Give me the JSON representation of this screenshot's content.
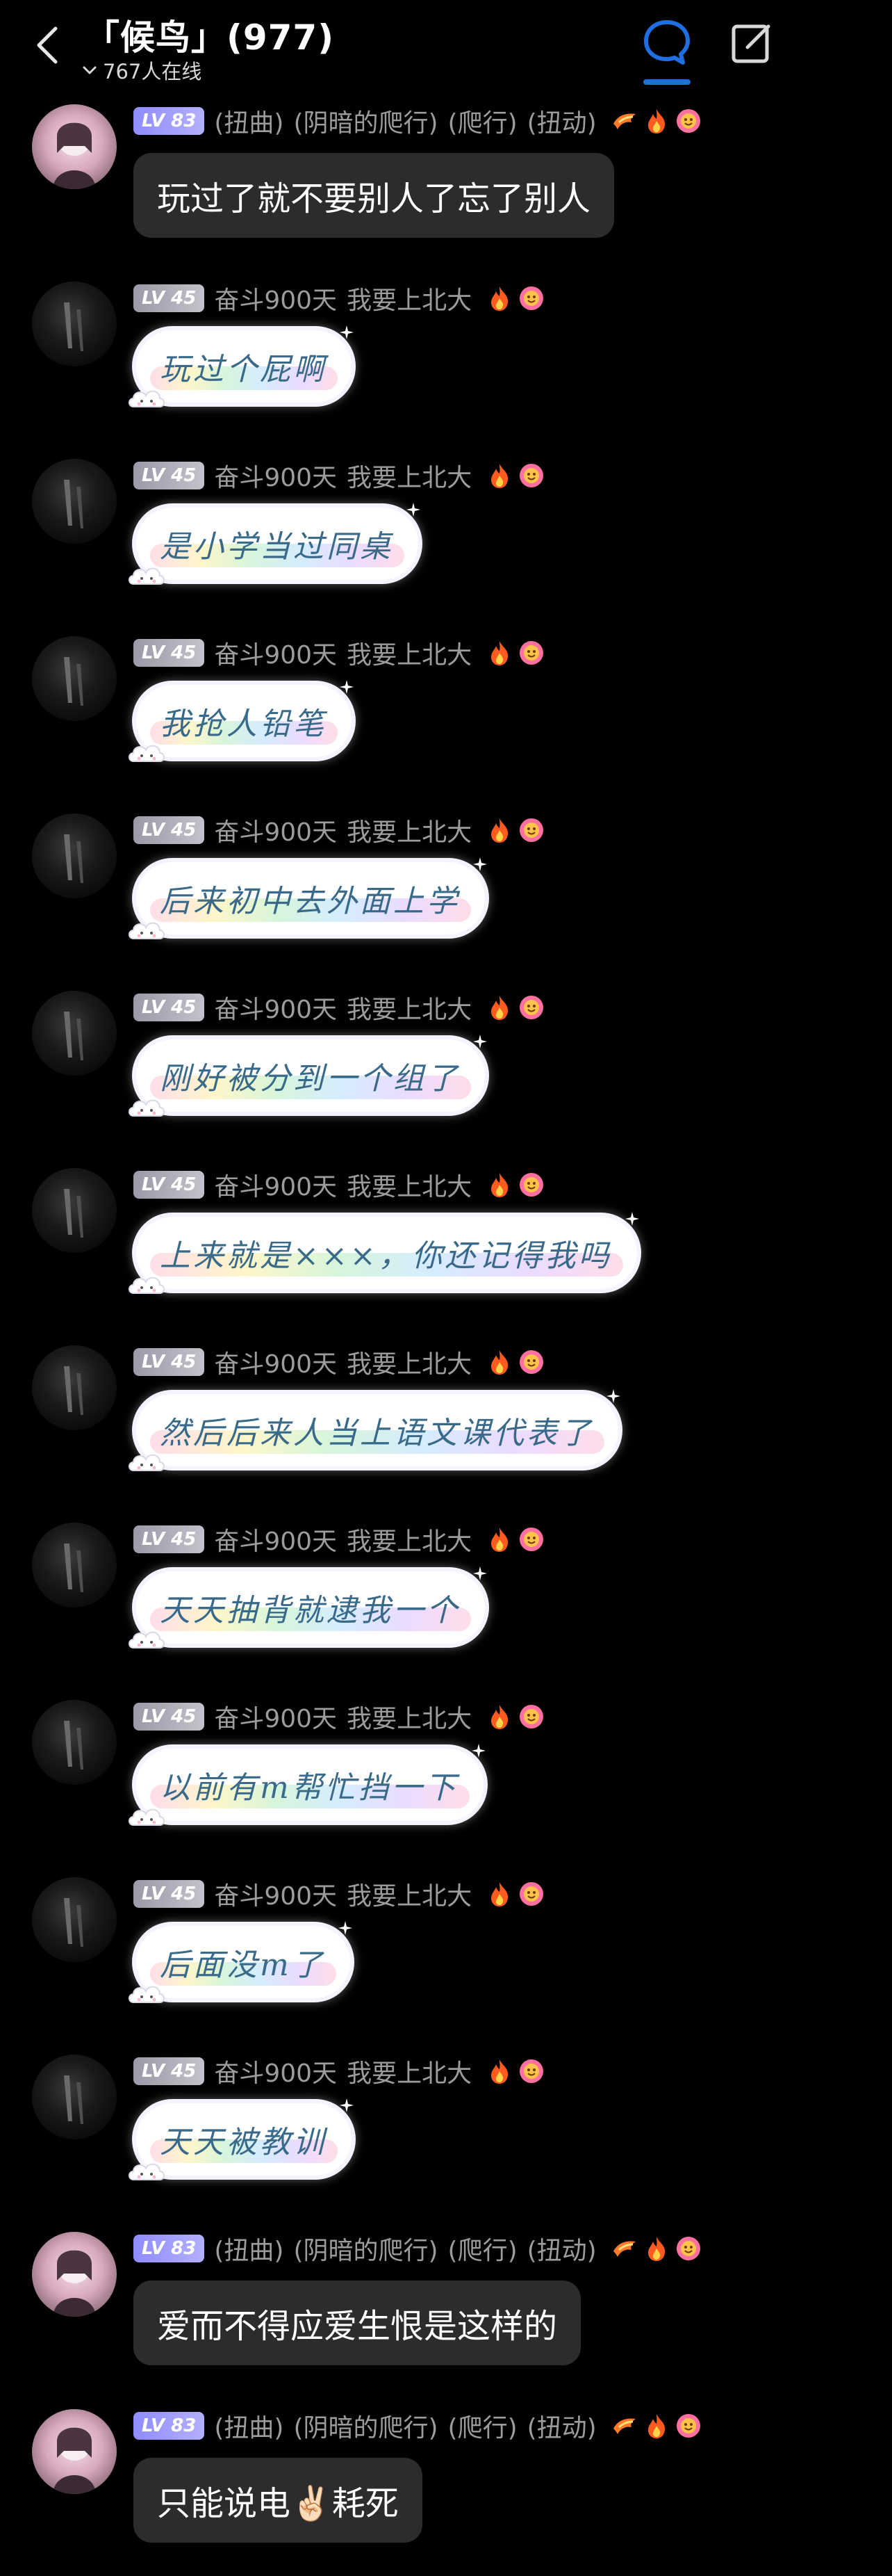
{
  "header": {
    "title": "「候鸟」(977)",
    "online": "767人在线"
  },
  "messages": [
    {
      "user": "a",
      "level": "LV 83",
      "tags": [
        "(扭曲)",
        "(阴暗的爬行)",
        "(爬行)",
        "(扭动)"
      ],
      "text": "玩过了就不要别人了忘了别人",
      "style": "plain"
    },
    {
      "user": "b",
      "level": "LV 45",
      "tags": [
        "奋斗900天",
        "我要上北大"
      ],
      "text": "玩过个屁啊",
      "style": "cloud"
    },
    {
      "user": "b",
      "level": "LV 45",
      "tags": [
        "奋斗900天",
        "我要上北大"
      ],
      "text": "是小学当过同桌",
      "style": "cloud"
    },
    {
      "user": "b",
      "level": "LV 45",
      "tags": [
        "奋斗900天",
        "我要上北大"
      ],
      "text": "我抢人铅笔",
      "style": "cloud"
    },
    {
      "user": "b",
      "level": "LV 45",
      "tags": [
        "奋斗900天",
        "我要上北大"
      ],
      "text": "后来初中去外面上学",
      "style": "cloud"
    },
    {
      "user": "b",
      "level": "LV 45",
      "tags": [
        "奋斗900天",
        "我要上北大"
      ],
      "text": "刚好被分到一个组了",
      "style": "cloud"
    },
    {
      "user": "b",
      "level": "LV 45",
      "tags": [
        "奋斗900天",
        "我要上北大"
      ],
      "text": "上来就是×××，你还记得我吗",
      "style": "cloud"
    },
    {
      "user": "b",
      "level": "LV 45",
      "tags": [
        "奋斗900天",
        "我要上北大"
      ],
      "text": "然后后来人当上语文课代表了",
      "style": "cloud"
    },
    {
      "user": "b",
      "level": "LV 45",
      "tags": [
        "奋斗900天",
        "我要上北大"
      ],
      "text": "天天抽背就逮我一个",
      "style": "cloud"
    },
    {
      "user": "b",
      "level": "LV 45",
      "tags": [
        "奋斗900天",
        "我要上北大"
      ],
      "text": "以前有m帮忙挡一下",
      "style": "cloud"
    },
    {
      "user": "b",
      "level": "LV 45",
      "tags": [
        "奋斗900天",
        "我要上北大"
      ],
      "text": "后面没m了",
      "style": "cloud"
    },
    {
      "user": "b",
      "level": "LV 45",
      "tags": [
        "奋斗900天",
        "我要上北大"
      ],
      "text": "天天被教训",
      "style": "cloud"
    },
    {
      "user": "a",
      "level": "LV 83",
      "tags": [
        "(扭曲)",
        "(阴暗的爬行)",
        "(爬行)",
        "(扭动)"
      ],
      "text": "爱而不得应爱生恨是这样的",
      "style": "plain"
    },
    {
      "user": "a",
      "level": "LV 83",
      "tags": [
        "(扭曲)",
        "(阴暗的爬行)",
        "(爬行)",
        "(扭动)"
      ],
      "text": "只能说电✌🏻耗死",
      "style": "plain"
    }
  ],
  "colors": {
    "accent": "#1e6fe0",
    "bubble": "#2c2c2e",
    "meta": "#9c9c9c"
  },
  "icons": {
    "back": "chevron-left-icon",
    "chat": "chat-bubble-icon",
    "edit": "edit-icon"
  }
}
